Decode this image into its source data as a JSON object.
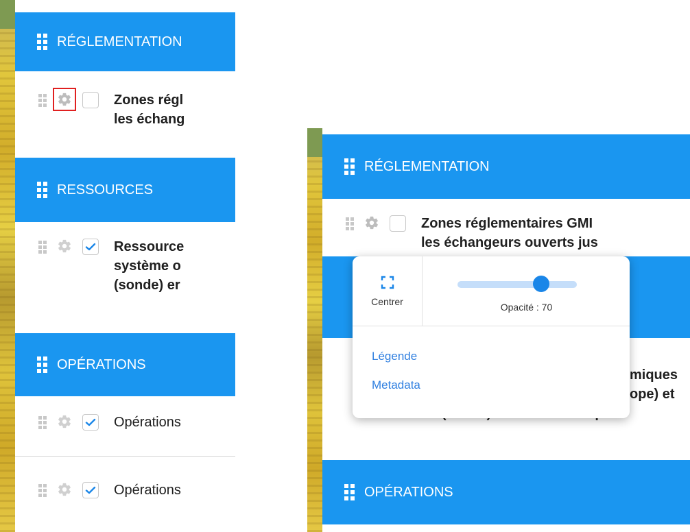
{
  "left_panel": {
    "sections": [
      {
        "title": "RÉGLEMENTATION"
      },
      {
        "title": "RESSOURCES"
      },
      {
        "title": "OPÉRATIONS"
      }
    ],
    "layers": [
      {
        "lines": [
          "Zones régl",
          "les échang"
        ],
        "checked": false
      },
      {
        "lines": [
          "Ressource",
          "système o",
          "(sonde) er"
        ],
        "checked": true
      },
      {
        "lines": [
          "Opérations"
        ],
        "checked": true
      },
      {
        "lines": [
          "Opérations"
        ],
        "checked": true
      }
    ]
  },
  "right_panel": {
    "sections": [
      {
        "title": "RÉGLEMENTATION"
      },
      {
        "title": "OPÉRATIONS"
      }
    ],
    "layers": [
      {
        "lines": [
          "Zones réglementaires GMI",
          "les échangeurs ouverts jus"
        ],
        "checked": false
      },
      {
        "lines": [
          "miques",
          "ope) et",
          "(sonde) en Provence-Alpes"
        ]
      }
    ]
  },
  "popup": {
    "center_label": "Centrer",
    "opacity_label": "Opacité : 70",
    "opacity_value": 70,
    "links": {
      "legend": "Légende",
      "metadata": "Metadata"
    }
  },
  "colors": {
    "header_blue": "#1a96f0",
    "checkmark_blue": "#1a86e8",
    "link_blue": "#2f7fe0",
    "highlight_red": "#e02020"
  },
  "icons": {
    "drag_handle": "drag-handle-icon",
    "gear": "gear-icon",
    "check": "check-icon",
    "center": "fullscreen-center-icon"
  }
}
